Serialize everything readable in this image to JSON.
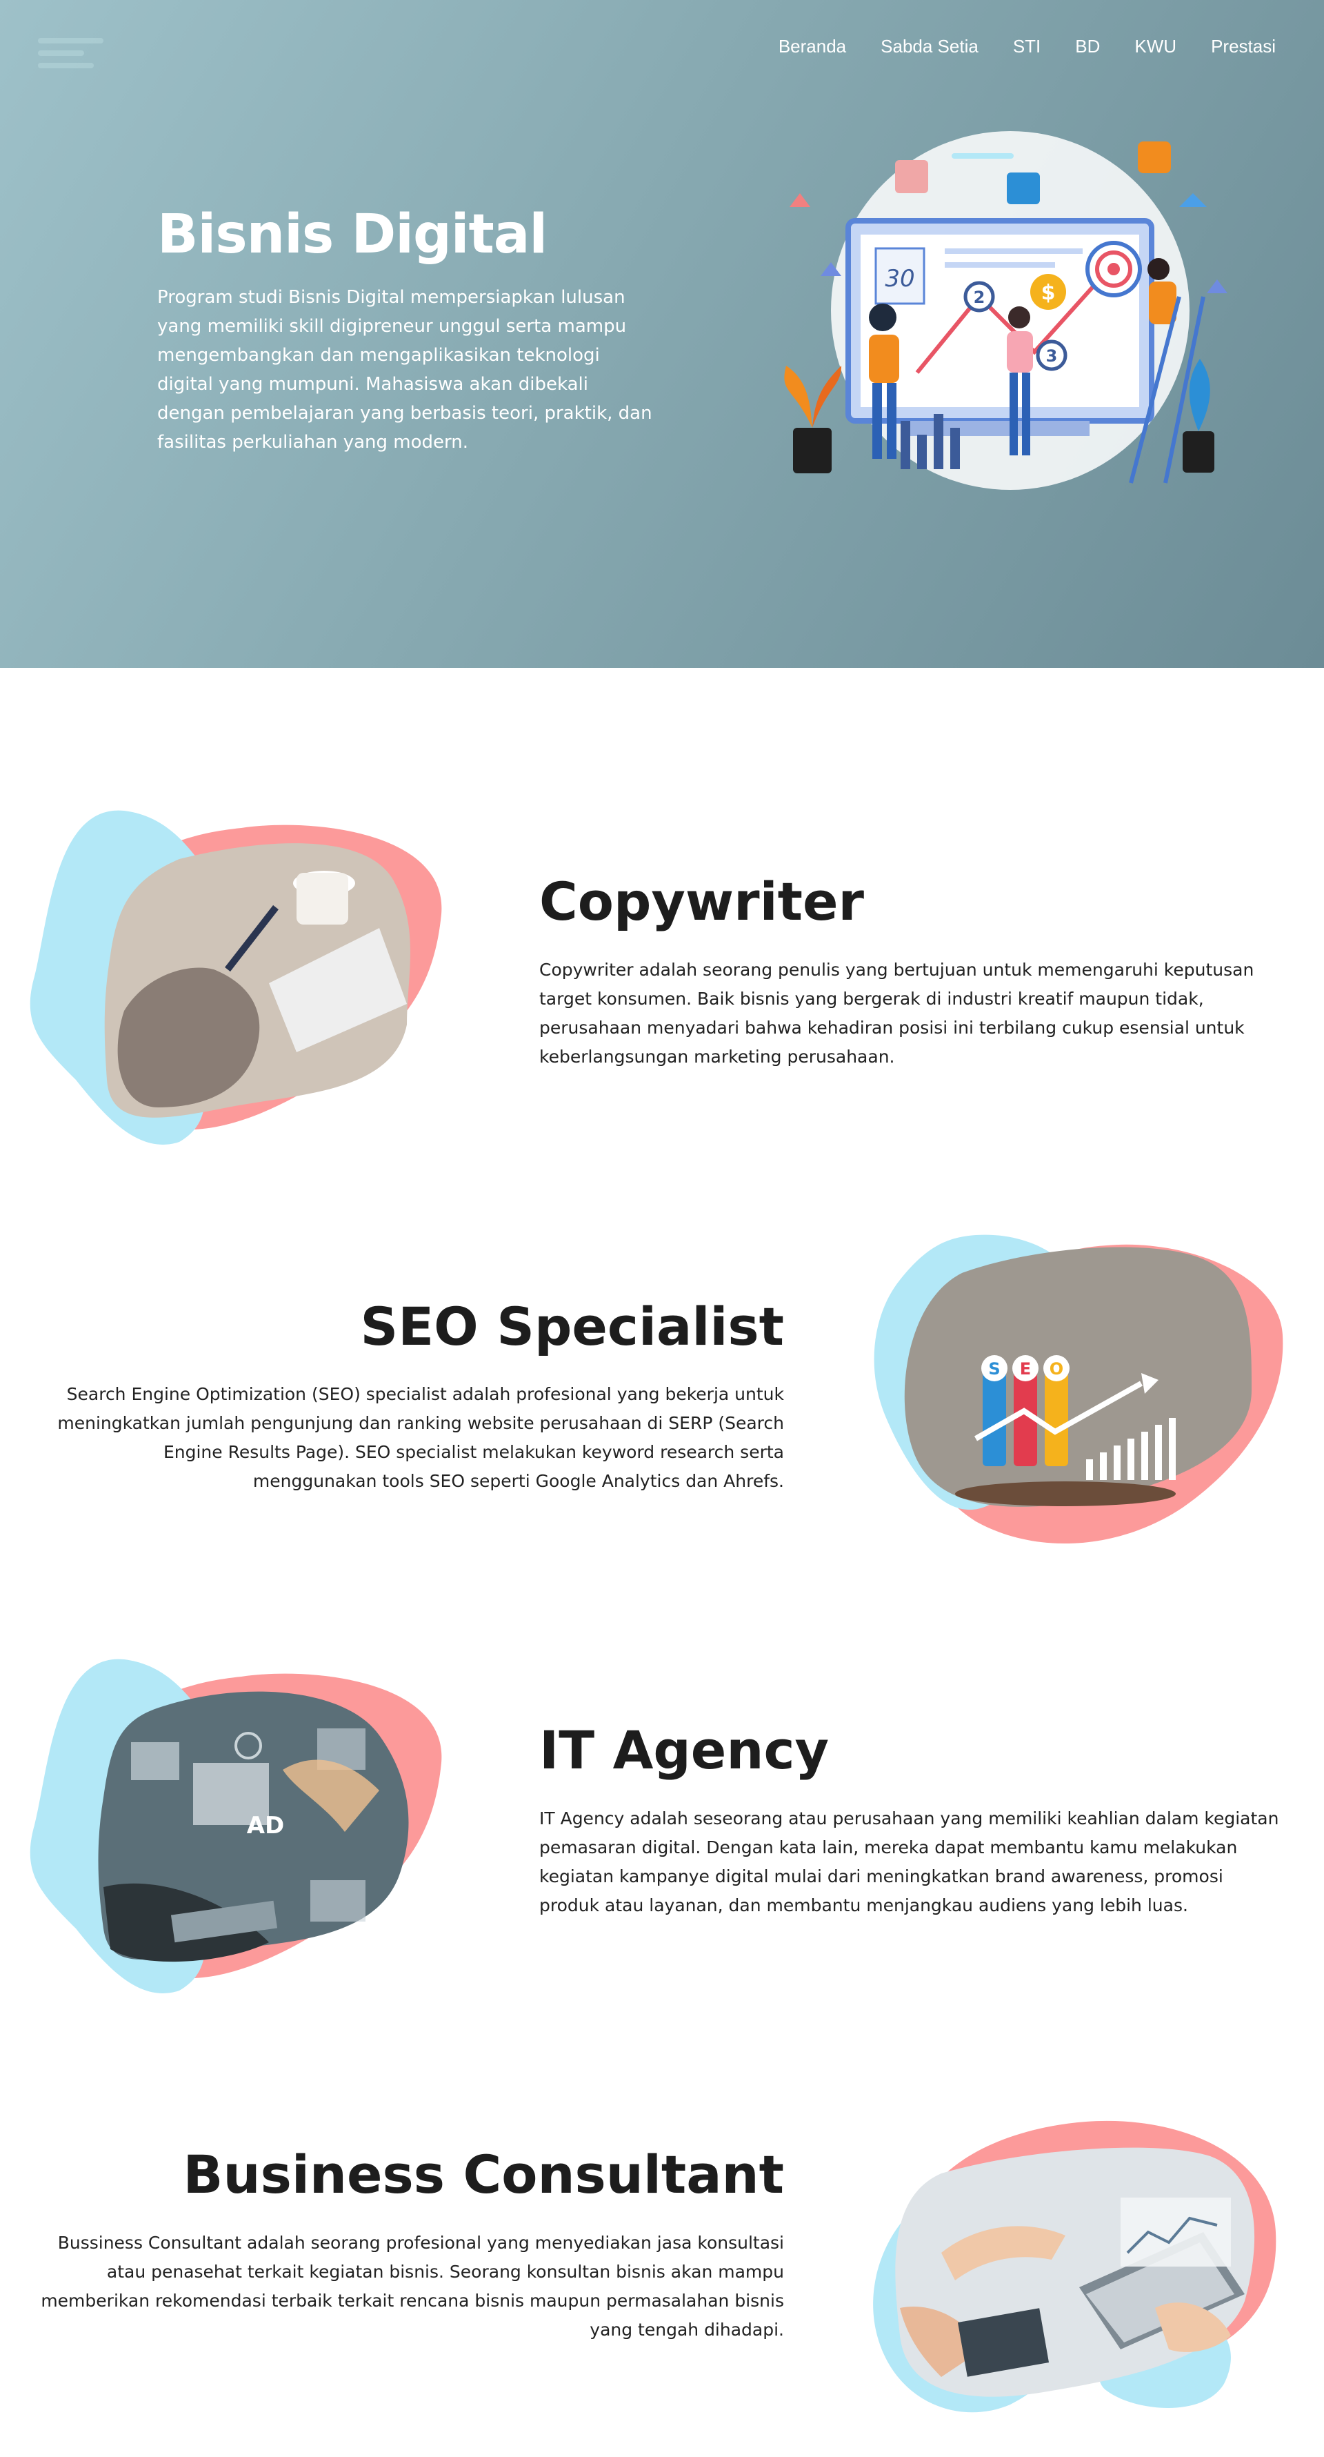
{
  "nav": {
    "items": [
      "Beranda",
      "Sabda Setia",
      "STI",
      "BD",
      "KWU",
      "Prestasi"
    ]
  },
  "hero": {
    "title": "Bisnis Digital",
    "description": "Program studi Bisnis Digital mempersiapkan lulusan yang memiliki skill digipreneur unggul serta mampu mengembangkan dan mengaplikasikan teknologi digital yang mumpuni. Mahasiswa akan dibekali dengan pembelajaran yang berbasis teori, praktik, dan fasilitas perkuliahan yang modern.",
    "illustration_labels": [
      "30",
      "2",
      "3",
      "$"
    ]
  },
  "careers": [
    {
      "title": "Copywriter",
      "description": "Copywriter adalah seorang penulis yang bertujuan untuk memengaruhi keputusan target konsumen. Baik bisnis yang bergerak di industri kreatif maupun tidak, perusahaan menyadari bahwa kehadiran posisi ini terbilang cukup esensial untuk keberlangsungan marketing perusahaan."
    },
    {
      "title": "SEO Specialist",
      "description": "Search Engine Optimization (SEO) specialist adalah profesional yang bekerja untuk meningkatkan jumlah pengunjung dan ranking website perusahaan di SERP (Search Engine Results Page). SEO specialist melakukan keyword research serta menggunakan tools SEO seperti Google Analytics dan Ahrefs.",
      "image_letters": [
        "S",
        "E",
        "O"
      ]
    },
    {
      "title": "IT Agency",
      "description": "IT Agency adalah seseorang atau perusahaan yang memiliki keahlian dalam kegiatan pemasaran digital. Dengan kata lain, mereka dapat membantu kamu melakukan kegiatan kampanye digital mulai dari meningkatkan brand awareness, promosi produk atau layanan, dan membantu menjangkau audiens yang lebih luas.",
      "image_label": "AD"
    },
    {
      "title": "Business Consultant",
      "description": "Bussiness Consultant adalah seorang profesional yang menyediakan jasa konsultasi atau penasehat terkait kegiatan bisnis. Seorang konsultan bisnis akan mampu memberikan rekomendasi terbaik terkait rencana bisnis maupun permasalahan bisnis yang tengah dihadapi."
    }
  ],
  "colors": {
    "blob_blue": "#b3e8f7",
    "blob_pink": "#fc9a9a",
    "hero_start": "#9ec1c9",
    "hero_end": "#6c8c96"
  }
}
